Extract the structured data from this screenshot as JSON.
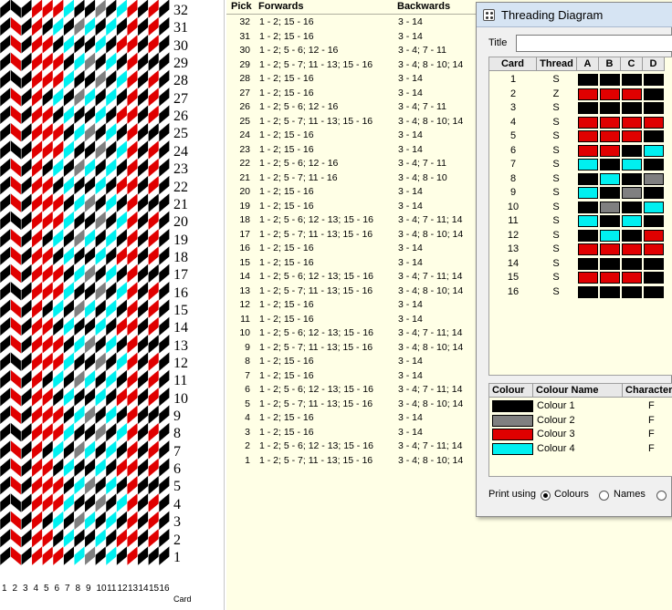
{
  "left_panel": {
    "row_numbers": [
      "32",
      "31",
      "30",
      "29",
      "28",
      "27",
      "26",
      "25",
      "24",
      "23",
      "22",
      "21",
      "20",
      "19",
      "18",
      "17",
      "16",
      "15",
      "14",
      "13",
      "12",
      "11",
      "10",
      "9",
      "8",
      "7",
      "6",
      "5",
      "4",
      "3",
      "2",
      "1"
    ],
    "column_numbers": [
      "1",
      "2",
      "3",
      "4",
      "5",
      "6",
      "7",
      "8",
      "9",
      "10",
      "11",
      "12",
      "13",
      "14",
      "15",
      "16"
    ],
    "card_label": "Card"
  },
  "pick_table": {
    "headers": {
      "pick": "Pick",
      "forwards": "Forwards",
      "backwards": "Backwards"
    },
    "rows": [
      {
        "pick": "32",
        "forwards": "1 - 2; 15 - 16",
        "backwards": "3 - 14"
      },
      {
        "pick": "31",
        "forwards": "1 - 2; 15 - 16",
        "backwards": "3 - 14"
      },
      {
        "pick": "30",
        "forwards": "1 - 2; 5 - 6; 12 - 16",
        "backwards": "3 - 4; 7 - 11"
      },
      {
        "pick": "29",
        "forwards": "1 - 2; 5 - 7; 11 - 13; 15 - 16",
        "backwards": "3 - 4; 8 - 10; 14"
      },
      {
        "pick": "28",
        "forwards": "1 - 2; 15 - 16",
        "backwards": "3 - 14"
      },
      {
        "pick": "27",
        "forwards": "1 - 2; 15 - 16",
        "backwards": "3 - 14"
      },
      {
        "pick": "26",
        "forwards": "1 - 2; 5 - 6; 12 - 16",
        "backwards": "3 - 4; 7 - 11"
      },
      {
        "pick": "25",
        "forwards": "1 - 2; 5 - 7; 11 - 13; 15 - 16",
        "backwards": "3 - 4; 8 - 10; 14"
      },
      {
        "pick": "24",
        "forwards": "1 - 2; 15 - 16",
        "backwards": "3 - 14"
      },
      {
        "pick": "23",
        "forwards": "1 - 2; 15 - 16",
        "backwards": "3 - 14"
      },
      {
        "pick": "22",
        "forwards": "1 - 2; 5 - 6; 12 - 16",
        "backwards": "3 - 4; 7 - 11"
      },
      {
        "pick": "21",
        "forwards": "1 - 2; 5 - 7; 11 - 16",
        "backwards": "3 - 4; 8 - 10"
      },
      {
        "pick": "20",
        "forwards": "1 - 2; 15 - 16",
        "backwards": "3 - 14"
      },
      {
        "pick": "19",
        "forwards": "1 - 2; 15 - 16",
        "backwards": "3 - 14"
      },
      {
        "pick": "18",
        "forwards": "1 - 2; 5 - 6; 12 - 13; 15 - 16",
        "backwards": "3 - 4; 7 - 11; 14"
      },
      {
        "pick": "17",
        "forwards": "1 - 2; 5 - 7; 11 - 13; 15 - 16",
        "backwards": "3 - 4; 8 - 10; 14"
      },
      {
        "pick": "16",
        "forwards": "1 - 2; 15 - 16",
        "backwards": "3 - 14"
      },
      {
        "pick": "15",
        "forwards": "1 - 2; 15 - 16",
        "backwards": "3 - 14"
      },
      {
        "pick": "14",
        "forwards": "1 - 2; 5 - 6; 12 - 13; 15 - 16",
        "backwards": "3 - 4; 7 - 11; 14"
      },
      {
        "pick": "13",
        "forwards": "1 - 2; 5 - 7; 11 - 13; 15 - 16",
        "backwards": "3 - 4; 8 - 10; 14"
      },
      {
        "pick": "12",
        "forwards": "1 - 2; 15 - 16",
        "backwards": "3 - 14"
      },
      {
        "pick": "11",
        "forwards": "1 - 2; 15 - 16",
        "backwards": "3 - 14"
      },
      {
        "pick": "10",
        "forwards": "1 - 2; 5 - 6; 12 - 13; 15 - 16",
        "backwards": "3 - 4; 7 - 11; 14"
      },
      {
        "pick": "9",
        "forwards": "1 - 2; 5 - 7; 11 - 13; 15 - 16",
        "backwards": "3 - 4; 8 - 10; 14"
      },
      {
        "pick": "8",
        "forwards": "1 - 2; 15 - 16",
        "backwards": "3 - 14"
      },
      {
        "pick": "7",
        "forwards": "1 - 2; 15 - 16",
        "backwards": "3 - 14"
      },
      {
        "pick": "6",
        "forwards": "1 - 2; 5 - 6; 12 - 13; 15 - 16",
        "backwards": "3 - 4; 7 - 11; 14"
      },
      {
        "pick": "5",
        "forwards": "1 - 2; 5 - 7; 11 - 13; 15 - 16",
        "backwards": "3 - 4; 8 - 10; 14"
      },
      {
        "pick": "4",
        "forwards": "1 - 2; 15 - 16",
        "backwards": "3 - 14"
      },
      {
        "pick": "3",
        "forwards": "1 - 2; 15 - 16",
        "backwards": "3 - 14"
      },
      {
        "pick": "2",
        "forwards": "1 - 2; 5 - 6; 12 - 13; 15 - 16",
        "backwards": "3 - 4; 7 - 11; 14"
      },
      {
        "pick": "1",
        "forwards": "1 - 2; 5 - 7; 11 - 13; 15 - 16",
        "backwards": "3 - 4; 8 - 10; 14"
      }
    ]
  },
  "dialog": {
    "title": "Threading Diagram",
    "title_label": "Title",
    "title_value": "",
    "card_headers": {
      "card": "Card",
      "thread": "Thread",
      "a": "A",
      "b": "B",
      "c": "C",
      "d": "D"
    },
    "cards": [
      {
        "card": "1",
        "thread": "S",
        "holes": [
          1,
          1,
          1,
          1
        ]
      },
      {
        "card": "2",
        "thread": "Z",
        "holes": [
          3,
          3,
          3,
          1
        ]
      },
      {
        "card": "3",
        "thread": "S",
        "holes": [
          1,
          1,
          1,
          1
        ]
      },
      {
        "card": "4",
        "thread": "S",
        "holes": [
          3,
          3,
          3,
          3
        ]
      },
      {
        "card": "5",
        "thread": "S",
        "holes": [
          3,
          3,
          3,
          1
        ]
      },
      {
        "card": "6",
        "thread": "S",
        "holes": [
          3,
          3,
          1,
          4
        ]
      },
      {
        "card": "7",
        "thread": "S",
        "holes": [
          4,
          1,
          4,
          1
        ]
      },
      {
        "card": "8",
        "thread": "S",
        "holes": [
          1,
          4,
          1,
          2
        ]
      },
      {
        "card": "9",
        "thread": "S",
        "holes": [
          4,
          1,
          2,
          1
        ]
      },
      {
        "card": "10",
        "thread": "S",
        "holes": [
          1,
          2,
          1,
          4
        ]
      },
      {
        "card": "11",
        "thread": "S",
        "holes": [
          4,
          1,
          4,
          1
        ]
      },
      {
        "card": "12",
        "thread": "S",
        "holes": [
          1,
          4,
          1,
          3
        ]
      },
      {
        "card": "13",
        "thread": "S",
        "holes": [
          3,
          3,
          3,
          3
        ]
      },
      {
        "card": "14",
        "thread": "S",
        "holes": [
          1,
          1,
          1,
          1
        ]
      },
      {
        "card": "15",
        "thread": "S",
        "holes": [
          3,
          3,
          3,
          1
        ]
      },
      {
        "card": "16",
        "thread": "S",
        "holes": [
          1,
          1,
          1,
          1
        ]
      }
    ],
    "colour_headers": {
      "colour": "Colour",
      "name": "Colour Name",
      "character": "Character"
    },
    "colours": [
      {
        "hex": "#000000",
        "name": "Colour 1",
        "character": "F"
      },
      {
        "hex": "#808080",
        "name": "Colour 2",
        "character": "F"
      },
      {
        "hex": "#e00000",
        "name": "Colour 3",
        "character": "F"
      },
      {
        "hex": "#00f0f0",
        "name": "Colour 4",
        "character": "F"
      }
    ],
    "print_using_label": "Print using",
    "print_options": [
      "Colours",
      "Names",
      ""
    ],
    "print_selected": "Colours"
  }
}
